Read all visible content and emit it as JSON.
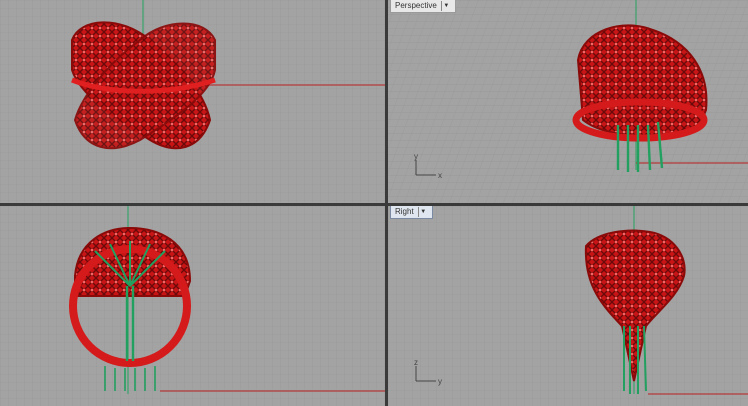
{
  "viewports": {
    "top_left": {
      "name": ""
    },
    "top_right": {
      "name": "Perspective",
      "axis_x": "x",
      "axis_y": "y"
    },
    "bottom_left": {
      "name": ""
    },
    "bottom_right": {
      "name": "Right",
      "axis_x": "y",
      "axis_y": "z"
    }
  },
  "colors": {
    "grid_bg": "#a3a3a3",
    "grid_minor": "#959595",
    "grid_major": "#8a8a8a",
    "axis_red": "#b33a3a",
    "axis_green": "#3ba36b",
    "model_red": "#d41a1a",
    "support_green": "#22a060"
  }
}
